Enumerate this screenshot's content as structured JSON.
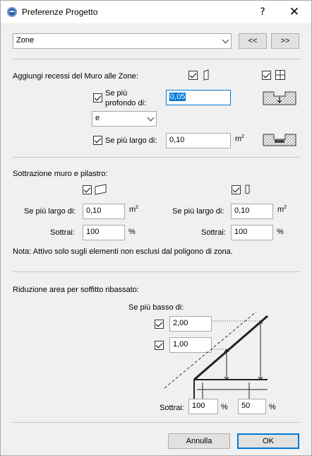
{
  "window": {
    "title": "Preferenze Progetto",
    "help_label": "?",
    "close_label": "✕"
  },
  "top": {
    "category_value": "Zone",
    "prev_label": "<<",
    "next_label": ">>"
  },
  "wall_recess": {
    "heading": "Aggiungi recessi del Muro alle Zone:",
    "deeper_checked": true,
    "deeper_label": "Se più profondo di:",
    "deeper_value": "0,05",
    "combo_value": "e",
    "wider_checked": true,
    "wider_label": "Se più largo di:",
    "wider_value": "0,10",
    "wider_unit": "m²"
  },
  "subtraction": {
    "heading": "Sottrazione muro e pilastro:",
    "wall": {
      "checked": true,
      "wider_label": "Se più largo di:",
      "wider_value": "0,10",
      "unit": "m²",
      "subtract_label": "Sottrai:",
      "subtract_value": "100",
      "subtract_unit": "%"
    },
    "column": {
      "checked": true,
      "wider_label": "Se più largo di:",
      "wider_value": "0,10",
      "unit": "m²",
      "subtract_label": "Sottrai:",
      "subtract_value": "100",
      "subtract_unit": "%"
    },
    "note": "Nota: Attivo solo sugli elementi non esclusi dal poligono di zona."
  },
  "ceiling": {
    "heading": "Riduzione area per soffitto ribassato:",
    "lower_label": "Se più basso di:",
    "height1_checked": true,
    "height1_value": "2,00",
    "height2_checked": true,
    "height2_value": "1,00",
    "subtract_label": "Sottrai:",
    "subtract1_value": "100",
    "subtract1_unit": "%",
    "subtract2_value": "50",
    "subtract2_unit": "%"
  },
  "footer": {
    "cancel_label": "Annulla",
    "ok_label": "OK"
  },
  "colors": {
    "accent": "#0078d7",
    "window_bg": "#f0f0f0"
  }
}
